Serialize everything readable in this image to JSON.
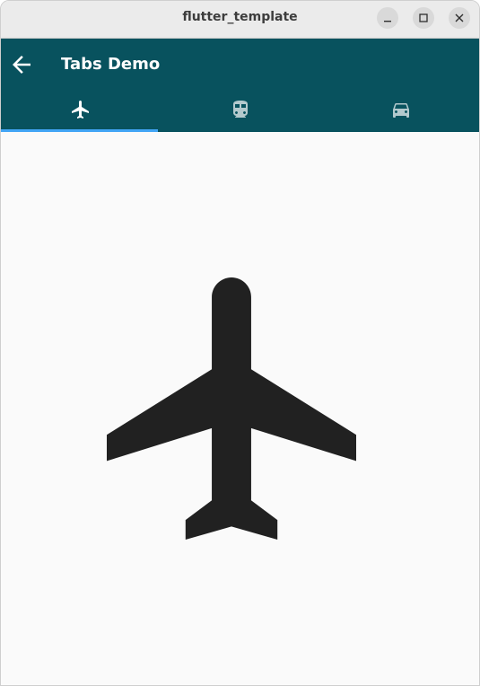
{
  "window": {
    "title": "flutter_template"
  },
  "appbar": {
    "title": "Tabs Demo",
    "background": "#08525e"
  },
  "tabs": [
    {
      "icon": "flight-icon",
      "selected": true
    },
    {
      "icon": "train-icon",
      "selected": false
    },
    {
      "icon": "car-icon",
      "selected": false
    }
  ],
  "indicator_color": "#42a5f5",
  "content": {
    "icon": "flight-icon",
    "icon_color": "#212121"
  }
}
